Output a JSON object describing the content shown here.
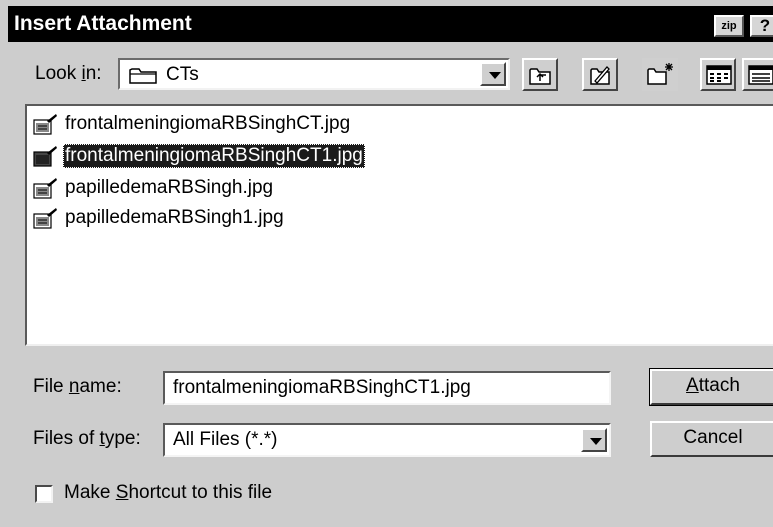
{
  "window": {
    "title": "Insert Attachment",
    "zip_button": "zip",
    "help_button": "?"
  },
  "look_in": {
    "label_pre": "Look ",
    "label_accel": "i",
    "label_post": "n:",
    "value": "CTs"
  },
  "toolbar": {
    "icons": [
      "up-one-level-icon",
      "favorites-icon",
      "new-folder-icon",
      "list-view-icon",
      "details-view-icon"
    ]
  },
  "files": [
    {
      "name": "frontalmeningiomaRBSinghCT.jpg",
      "selected": false
    },
    {
      "name": "frontalmeningiomaRBSinghCT1.jpg",
      "selected": true
    },
    {
      "name": "papilledemaRBSingh.jpg",
      "selected": false
    },
    {
      "name": "papilledemaRBSingh1.jpg",
      "selected": false
    }
  ],
  "file_name": {
    "label_pre": "File ",
    "label_accel": "n",
    "label_post": "ame:",
    "value": "frontalmeningiomaRBSinghCT1.jpg"
  },
  "file_type": {
    "label_pre": "Files of ",
    "label_accel": "t",
    "label_post": "ype:",
    "value": "All Files (*.*)"
  },
  "buttons": {
    "attach_accel": "A",
    "attach_rest": "ttach",
    "cancel": "Cancel"
  },
  "shortcut": {
    "label_pre": "Make ",
    "label_accel": "S",
    "label_post": "hortcut to this file",
    "checked": false
  }
}
